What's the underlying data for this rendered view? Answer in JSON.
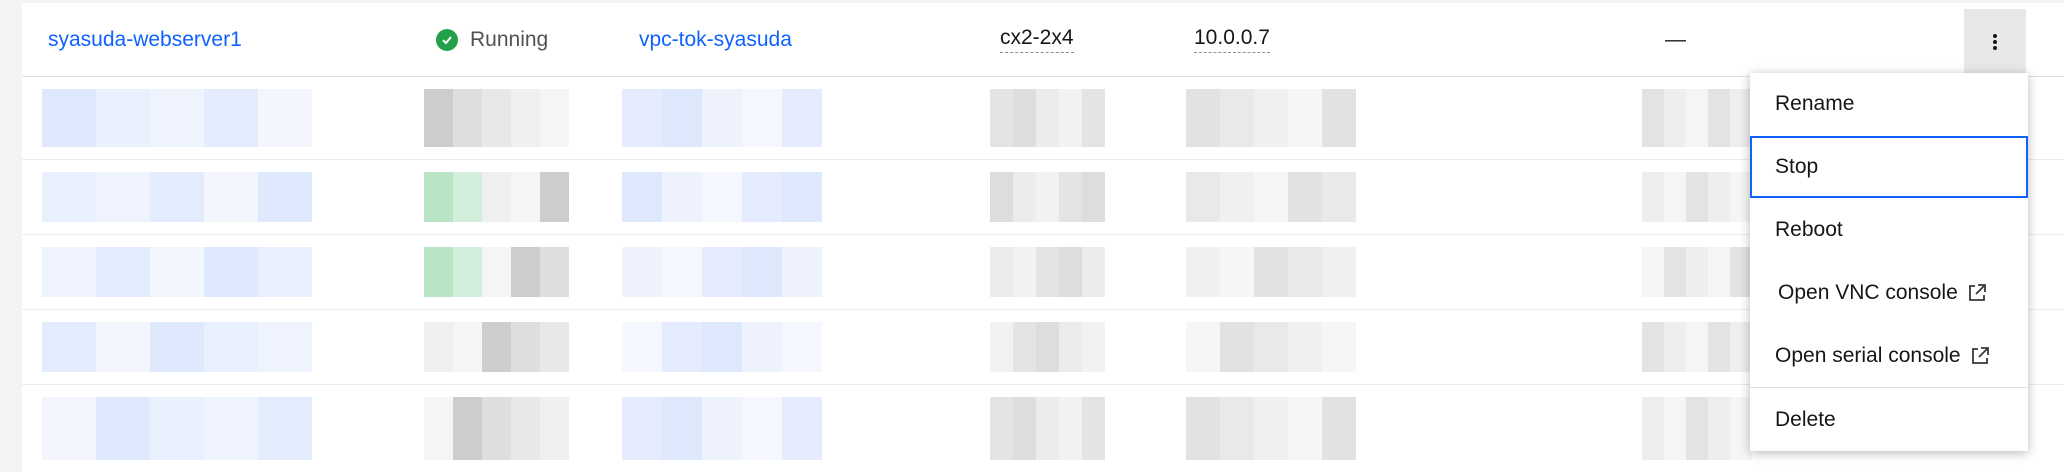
{
  "instance": {
    "name": "syasuda-webserver1",
    "status": "Running",
    "vpc": "vpc-tok-syasuda",
    "profile": "cx2-2x4",
    "ip": "10.0.0.7",
    "floating_ip": "—"
  },
  "overflow_menu": {
    "items": [
      {
        "label": "Rename",
        "external": false,
        "selected": false
      },
      {
        "label": "Stop",
        "external": false,
        "selected": true
      },
      {
        "label": "Reboot",
        "external": false,
        "selected": false
      },
      {
        "label": "Open VNC console",
        "external": true,
        "selected": false
      },
      {
        "label": "Open serial console",
        "external": true,
        "selected": false
      },
      {
        "label": "Delete",
        "external": false,
        "selected": false
      }
    ]
  },
  "colors": {
    "link": "#0f62fe",
    "status_running": "#24a148",
    "focus": "#0f62fe"
  },
  "icons": {
    "status": "checkmark-filled-icon",
    "overflow": "overflow-menu-vertical-icon",
    "external": "launch-icon"
  }
}
